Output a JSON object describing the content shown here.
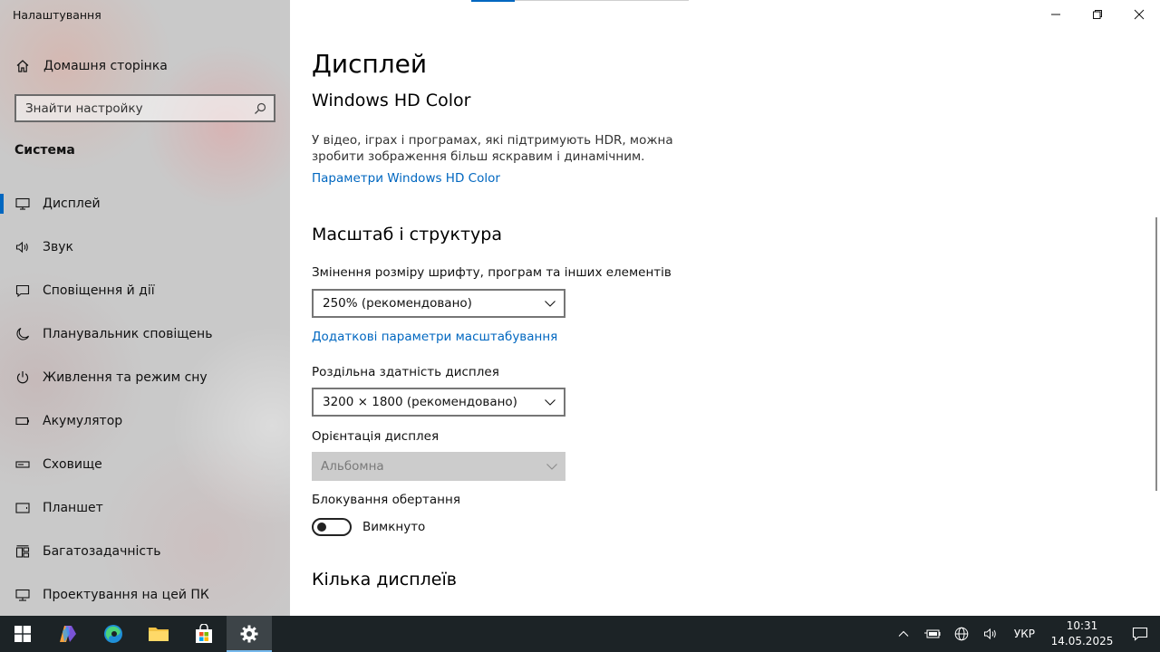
{
  "window": {
    "app_title": "Налаштування"
  },
  "sidebar": {
    "home_label": "Домашня сторінка",
    "search_placeholder": "Знайти настройку",
    "section_label": "Система",
    "items": [
      {
        "label": "Дисплей",
        "icon": "monitor-icon",
        "active": true
      },
      {
        "label": "Звук",
        "icon": "speaker-icon"
      },
      {
        "label": "Сповіщення й дії",
        "icon": "message-icon"
      },
      {
        "label": "Планувальник сповіщень",
        "icon": "moon-icon"
      },
      {
        "label": "Живлення та режим сну",
        "icon": "power-icon"
      },
      {
        "label": "Акумулятор",
        "icon": "battery-icon"
      },
      {
        "label": "Сховище",
        "icon": "storage-icon"
      },
      {
        "label": "Планшет",
        "icon": "tablet-icon"
      },
      {
        "label": "Багатозадачність",
        "icon": "multitask-icon"
      },
      {
        "label": "Проектування на цей ПК",
        "icon": "projection-icon"
      }
    ]
  },
  "main": {
    "page_title": "Дисплей",
    "hdr": {
      "heading": "Windows HD Color",
      "description": "У відео, іграх і програмах, які підтримують HDR, можна зробити зображення більш яскравим і динамічним.",
      "link": "Параметри Windows HD Color"
    },
    "scale": {
      "heading": "Масштаб і структура",
      "size_label": "Змінення розміру шрифту, програм та інших елементів",
      "size_value": "250% (рекомендовано)",
      "advanced_link": "Додаткові параметри масштабування",
      "resolution_label": "Роздільна здатність дисплея",
      "resolution_value": "3200 × 1800 (рекомендовано)",
      "orientation_label": "Орієнтація дисплея",
      "orientation_value": "Альбомна",
      "rotation_lock_label": "Блокування обертання",
      "rotation_lock_state": "Вимкнуто"
    },
    "multi": {
      "heading": "Кілька дисплеїв"
    }
  },
  "taskbar": {
    "language": "УКР",
    "time": "10:31",
    "date": "14.05.2025"
  },
  "colors": {
    "accent": "#0067c0",
    "taskbar": "#1c2326",
    "sidebar": "#c9c9c9"
  }
}
